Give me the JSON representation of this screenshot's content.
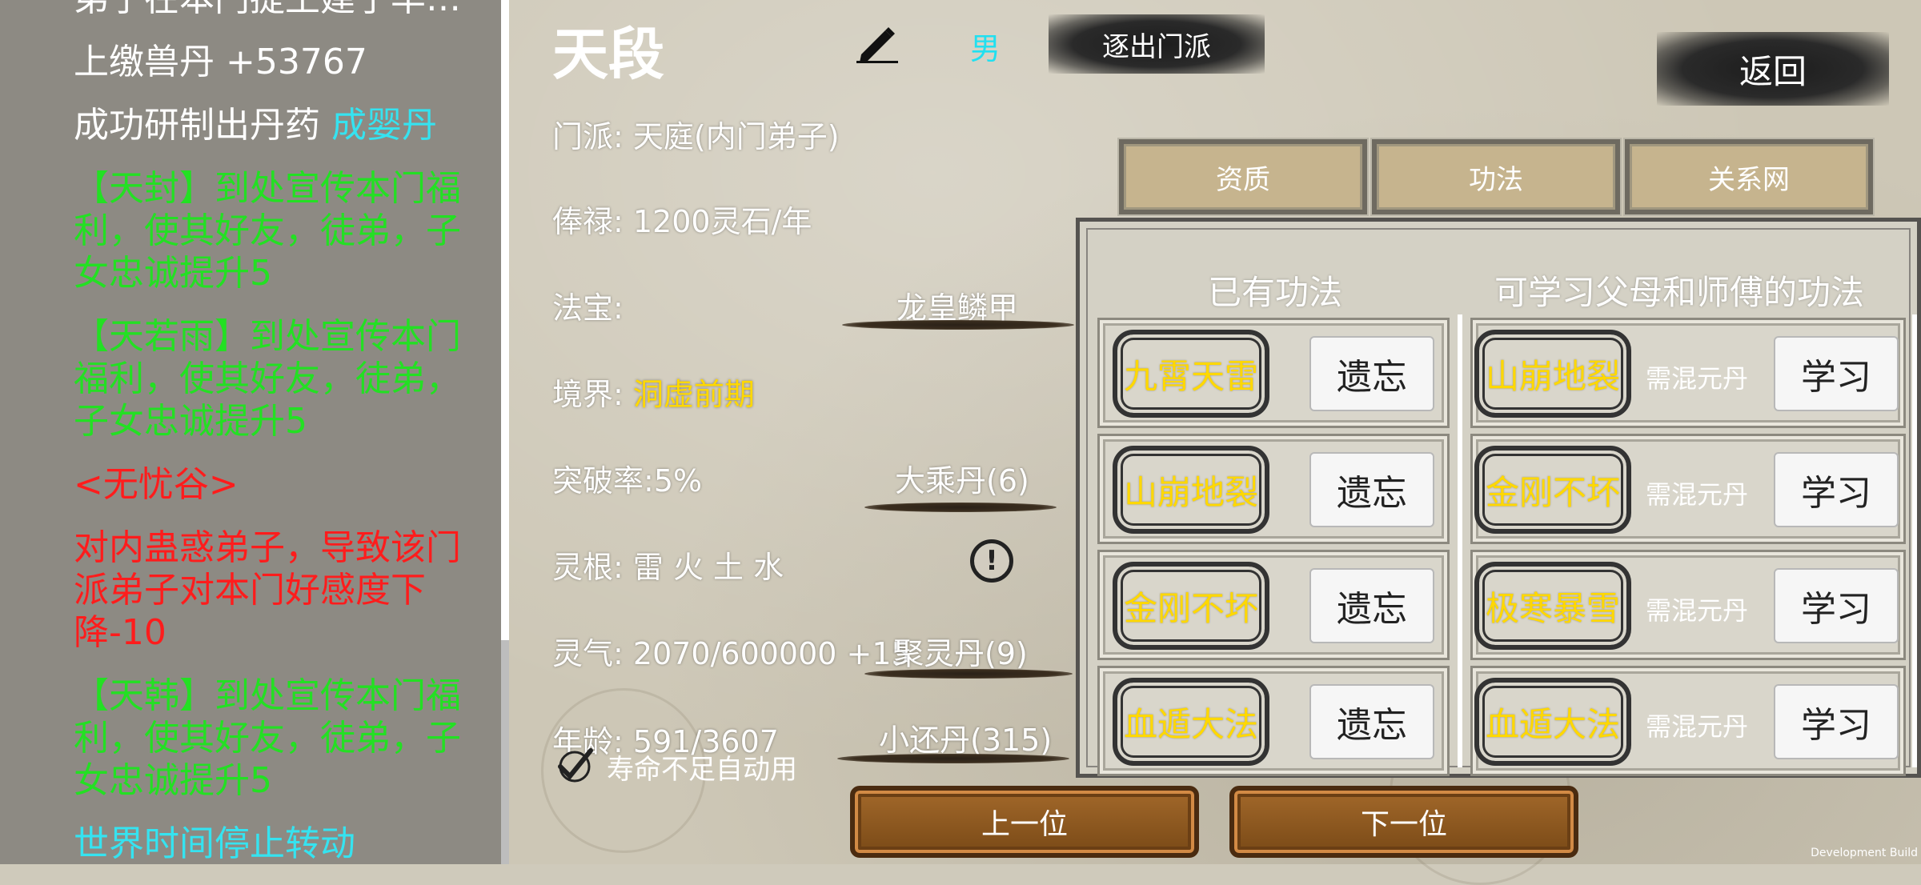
{
  "log": {
    "entries": [
      {
        "parts": [
          {
            "text": "弟子在本门提土建了华…",
            "color": "white"
          }
        ]
      },
      {
        "parts": [
          {
            "text": "上缴兽丹 +53767",
            "color": "white"
          }
        ]
      },
      {
        "parts": [
          {
            "text": "成功研制出丹药 ",
            "color": "white"
          },
          {
            "text": "成婴丹",
            "color": "cyan"
          }
        ]
      },
      {
        "parts": [
          {
            "text": "【天封】到处宣传本门福利，使其好友，徒弟，子女忠诚提升5",
            "color": "green"
          }
        ]
      },
      {
        "parts": [
          {
            "text": "【天若雨】到处宣传本门福利，使其好友，徒弟，子女忠诚提升5",
            "color": "green"
          }
        ]
      },
      {
        "parts": [
          {
            "text": "<无忧谷>",
            "color": "red"
          }
        ]
      },
      {
        "parts": [
          {
            "text": "对内蛊惑弟子，导致该门派弟子对本门好感度下降-10",
            "color": "red"
          }
        ]
      },
      {
        "parts": [
          {
            "text": "【天韩】到处宣传本门福利，使其好友，徒弟，子女忠诚提升5",
            "color": "green"
          }
        ]
      },
      {
        "parts": [
          {
            "text": "世界时间停止转动",
            "color": "cyan"
          }
        ]
      }
    ]
  },
  "character": {
    "name": "天段",
    "gender": "男",
    "expel_label": "逐出门派",
    "return_label": "返回",
    "sect_label": "门派: ",
    "sect_value": "天庭(内门弟子)",
    "salary_label": "俸禄: ",
    "salary_value": "1200灵石/年",
    "treasure_label": "法宝:",
    "treasure_value": "龙皇鳞甲",
    "realm_label": "境界: ",
    "realm_value": "洞虚前期",
    "breakthrough_label": "突破率:",
    "breakthrough_value": "5%",
    "breakthrough_pill": "大乘丹(6)",
    "root_label": "灵根: ",
    "root_value": "雷 火 土 水",
    "qi_label": "灵气: ",
    "qi_value": "2070/600000 +15",
    "qi_pill": "聚灵丹(9)",
    "age_label": "年龄: ",
    "age_value": "591/3607",
    "age_pill": "小还丹(315)",
    "auto_use_label": "寿命不足自动用",
    "auto_use_checked": true
  },
  "tabs": [
    "资质",
    "功法",
    "关系网"
  ],
  "kungfu": {
    "owned_title": "已有功法",
    "learnable_title": "可学习父母和师傅的功法",
    "owned": [
      {
        "name": "九霄天雷",
        "action": "遗忘"
      },
      {
        "name": "山崩地裂",
        "action": "遗忘"
      },
      {
        "name": "金刚不坏",
        "action": "遗忘"
      },
      {
        "name": "血遁大法",
        "action": "遗忘"
      }
    ],
    "learnable": [
      {
        "name": "山崩地裂",
        "requirement": "需混元丹",
        "action": "学习"
      },
      {
        "name": "金刚不坏",
        "requirement": "需混元丹",
        "action": "学习"
      },
      {
        "name": "极寒暴雪",
        "requirement": "需混元丹",
        "action": "学习"
      },
      {
        "name": "血遁大法",
        "requirement": "需混元丹",
        "action": "学习"
      }
    ]
  },
  "nav": {
    "prev_label": "上一位",
    "next_label": "下一位"
  },
  "footer": {
    "build_label": "Development Build"
  },
  "colors": {
    "white": "#ffffff",
    "cyan": "#35e3f0",
    "green": "#23e023",
    "red": "#ff1c1c",
    "yellow": "#ffd800"
  },
  "icons": {
    "edit": "pencil-icon",
    "warn": "exclamation-circle-icon",
    "check": "checkmark-icon"
  }
}
